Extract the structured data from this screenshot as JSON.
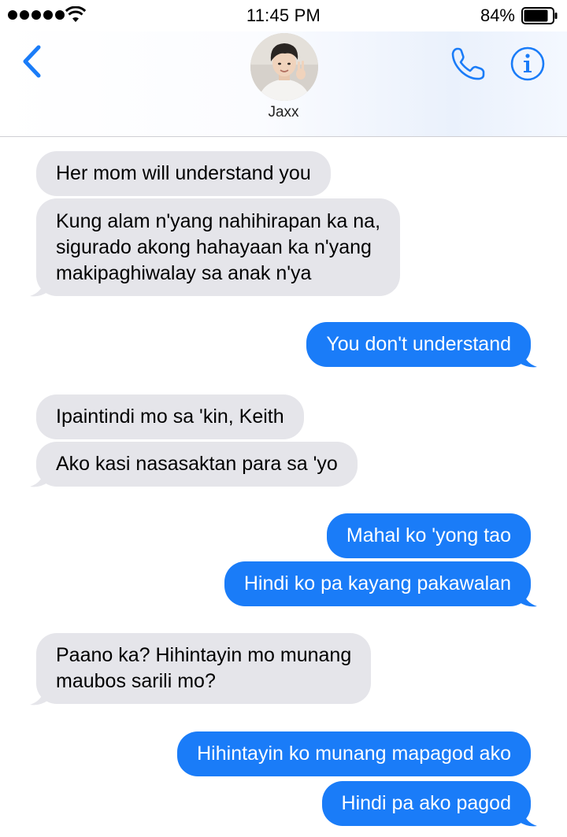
{
  "status_bar": {
    "time": "11:45 PM",
    "battery_percent": "84%",
    "signal_bars": 5
  },
  "header": {
    "contact_name": "Jaxx",
    "back_icon": "chevron-left-icon",
    "call_icon": "phone-icon",
    "info_icon": "info-icon"
  },
  "colors": {
    "accent": "#1a7cf8",
    "incoming_bubble": "#e5e5ea"
  },
  "messages": [
    {
      "direction": "in",
      "text": "Her mom will understand you"
    },
    {
      "direction": "in",
      "lines": [
        "Kung alam n'yang nahihirapan ka na,",
        "sigurado akong hahayaan ka n'yang",
        "makipaghiwalay sa anak n'ya"
      ]
    },
    {
      "direction": "out",
      "text": "You don't understand"
    },
    {
      "direction": "in",
      "text": "Ipaintindi mo sa 'kin, Keith"
    },
    {
      "direction": "in",
      "text": "Ako kasi nasasaktan para sa 'yo"
    },
    {
      "direction": "out",
      "text": "Mahal ko 'yong tao"
    },
    {
      "direction": "out",
      "text": "Hindi ko pa kayang pakawalan"
    },
    {
      "direction": "in",
      "lines": [
        "Paano ka? Hihintayin mo munang",
        "maubos sarili mo?"
      ]
    },
    {
      "direction": "out",
      "text": "Hihintayin ko munang mapagod ako"
    },
    {
      "direction": "out",
      "text": "Hindi pa ako pagod"
    }
  ]
}
